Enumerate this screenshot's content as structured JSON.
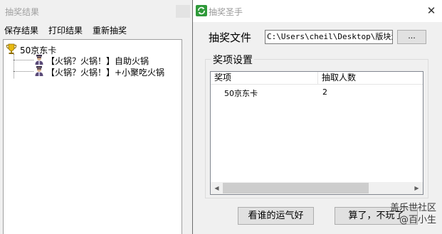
{
  "results_window": {
    "title": "抽奖结果",
    "menu": [
      "保存结果",
      "打印结果",
      "重新抽奖"
    ],
    "tree": {
      "root_label": "50京东卡",
      "root_icon": "trophy-icon",
      "children": [
        {
          "label": "【火锅？火锅！】自助火锅",
          "icon": "person-icon"
        },
        {
          "label": "【火锅？火锅！】+小聚吃火锅",
          "icon": "person-icon"
        }
      ]
    }
  },
  "lottery_window": {
    "title": "抽奖圣手",
    "close_glyph": "✕",
    "file_label": "抽奖文件",
    "file_path": "C:\\Users\\cheil\\Desktop\\版块活",
    "browse_label": "...",
    "group_title": "奖项设置",
    "columns": [
      "奖项",
      "抽取人数"
    ],
    "rows": [
      [
        "50京东卡",
        "2"
      ]
    ],
    "buttons": {
      "lucky": "看谁的运气好",
      "quit": "算了，不玩了"
    }
  },
  "watermark": {
    "line1": "盖乐世社区",
    "line2": "@百小生"
  },
  "colors": {
    "title_inactive": "#a0a0a0",
    "window_bg": "#f0f0f0",
    "scroll_thumb": "#cdcdcd"
  }
}
